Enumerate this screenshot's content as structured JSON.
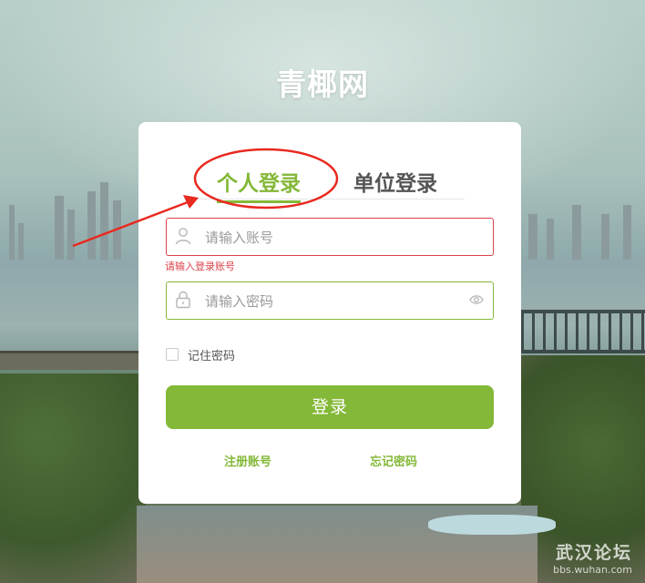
{
  "site": {
    "title": "青椰网"
  },
  "tabs": [
    {
      "label": "个人登录",
      "active": true
    },
    {
      "label": "单位登录",
      "active": false
    }
  ],
  "form": {
    "account_placeholder": "请输入账号",
    "account_error": "请输入登录账号",
    "password_placeholder": "请输入密码",
    "remember_label": "记住密码",
    "remember_checked": false,
    "login_label": "登录"
  },
  "links": {
    "register": "注册账号",
    "forgot": "忘记密码"
  },
  "colors": {
    "accent": "#84b838",
    "error": "#d9424b",
    "annotation": "#e8291f"
  },
  "watermark": {
    "main": "武汉论坛",
    "sub": "bbs.wuhan.com"
  }
}
